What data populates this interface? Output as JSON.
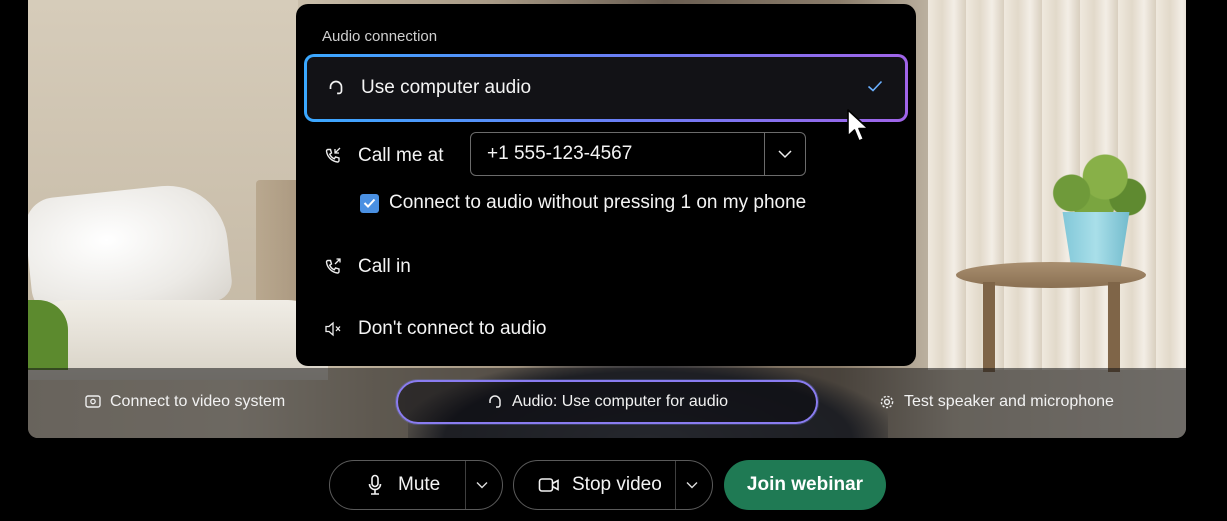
{
  "audio_panel": {
    "title": "Audio connection",
    "options": [
      {
        "label": "Use computer audio",
        "icon": "headset-icon",
        "selected": true
      },
      {
        "label": "Call me at",
        "icon": "phone-callback-icon"
      },
      {
        "label": "Call in",
        "icon": "phone-outgoing-icon"
      },
      {
        "label": "Don't connect to audio",
        "icon": "speaker-muted-icon"
      }
    ],
    "phone_number": "+1 555-123-4567",
    "connect_without_pressing_label": "Connect to audio without pressing 1 on my phone",
    "connect_without_pressing_checked": true
  },
  "preview_bar": {
    "connect_video_system": "Connect to video system",
    "audio_button": "Audio: Use computer for audio",
    "test_speaker": "Test speaker and microphone"
  },
  "controls": {
    "mute": "Mute",
    "stop_video": "Stop video",
    "join": "Join webinar"
  },
  "colors": {
    "accent_blue": "#3aa8ff",
    "accent_purple": "#a064e8",
    "join_green": "#1f7a54",
    "checkbox_blue": "#4a90e2"
  }
}
